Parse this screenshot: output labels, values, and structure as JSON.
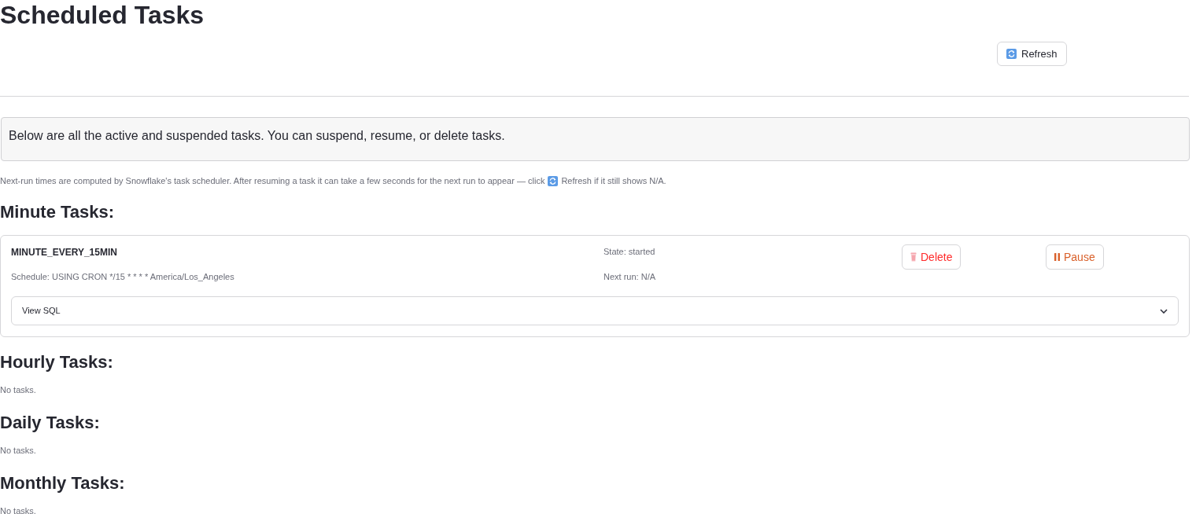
{
  "page": {
    "title": "Scheduled Tasks"
  },
  "refresh_button": {
    "label": "Refresh"
  },
  "info_box": {
    "text": "Below are all the active and suspended tasks. You can suspend, resume, or delete tasks."
  },
  "caption": {
    "text_before_icon": "Next-run times are computed by Snowflake's task scheduler. After resuming a task it can take a few seconds for the next run to appear — click",
    "text_after_icon": "Refresh if it still shows N/A."
  },
  "sections": [
    {
      "heading": "Minute Tasks:",
      "tasks": [
        {
          "name": "MINUTE_EVERY_15MIN",
          "schedule": "Schedule: USING CRON */15 * * * * America/Los_Angeles",
          "state": "State: started",
          "next_run": "Next run: N/A",
          "actions": [
            {
              "kind": "delete",
              "label": "Delete"
            },
            {
              "kind": "pause",
              "label": "Pause"
            }
          ],
          "sql_expander": {
            "label": "View SQL",
            "expanded": false
          }
        }
      ]
    },
    {
      "heading": "Hourly Tasks:",
      "empty_text": "No tasks."
    },
    {
      "heading": "Daily Tasks:",
      "empty_text": "No tasks."
    },
    {
      "heading": "Monthly Tasks:",
      "empty_text": "No tasks."
    }
  ]
}
